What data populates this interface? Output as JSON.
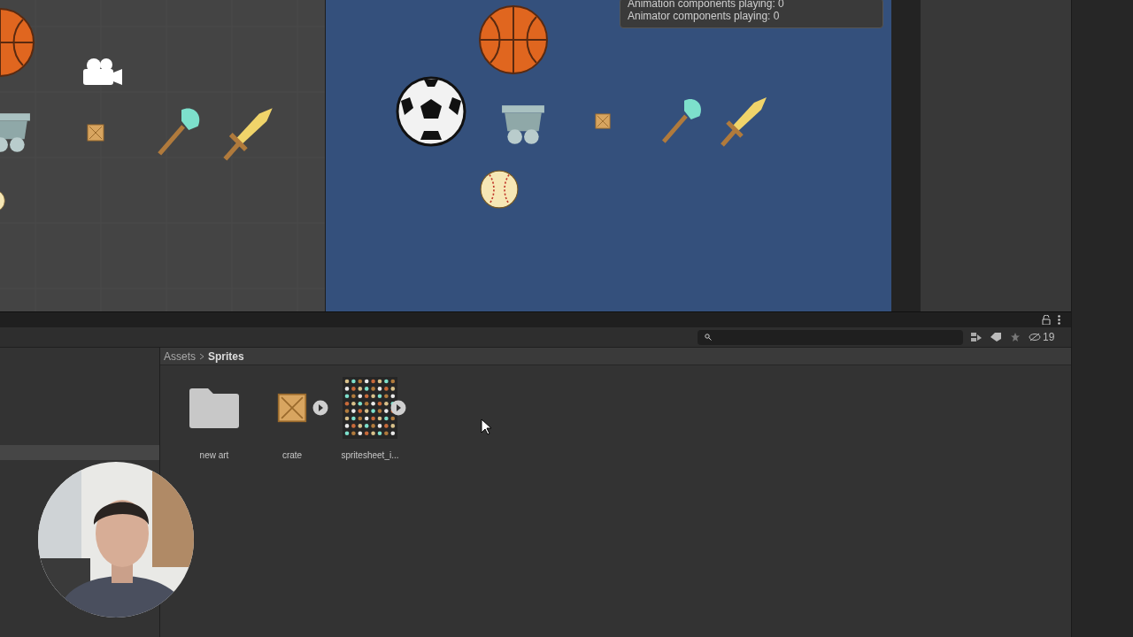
{
  "game_view": {
    "stats": [
      "Animation components playing: 0",
      "Animator components playing: 0"
    ]
  },
  "project": {
    "breadcrumb": [
      {
        "label": "Assets",
        "current": false
      },
      {
        "label": "Sprites",
        "current": true
      }
    ],
    "hidden_count": "19",
    "assets": [
      {
        "kind": "folder",
        "name": "new art",
        "expandable": false
      },
      {
        "kind": "sprite",
        "name": "crate",
        "expandable": true
      },
      {
        "kind": "sheet",
        "name": "spritesheet_i...",
        "expandable": true
      }
    ]
  }
}
